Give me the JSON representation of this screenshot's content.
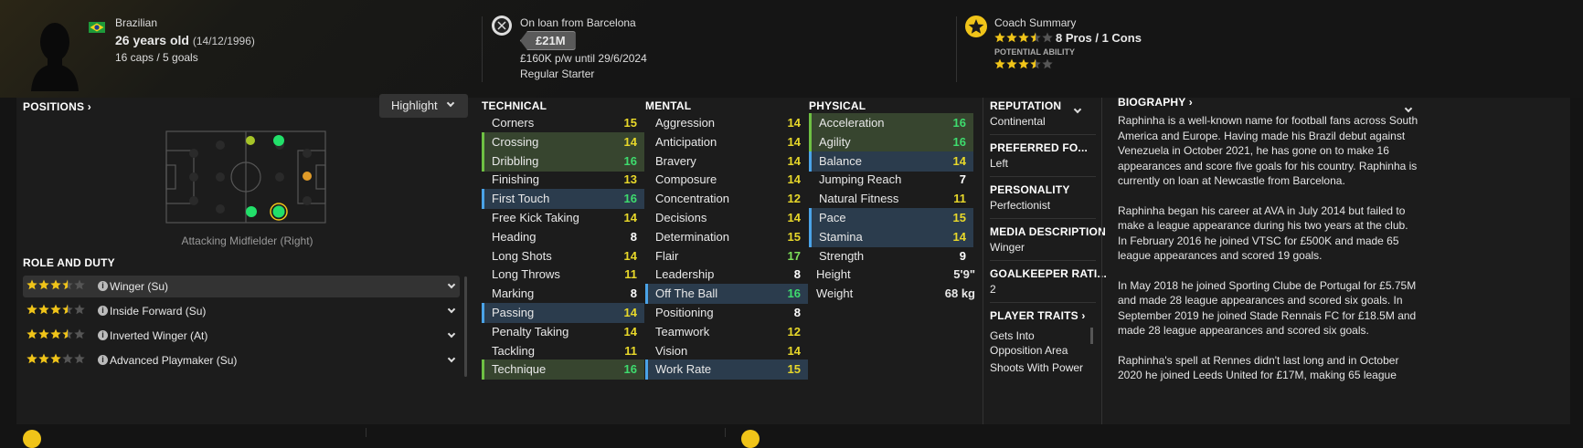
{
  "header": {
    "nationality": "Brazilian",
    "age": "26 years old",
    "dob": "(14/12/1996)",
    "caps_goals": "16 caps / 5 goals",
    "loan": "On loan from Barcelona",
    "value": "£21M",
    "wage": "£160K p/w until 29/6/2024",
    "squad_status": "Regular Starter",
    "coach_summary_label": "Coach Summary",
    "pros_cons": "8 Pros / 1 Cons",
    "potential_label": "POTENTIAL ABILITY",
    "current_stars": 3.5,
    "potential_stars": 3.5
  },
  "positions": {
    "title": "POSITIONS",
    "highlight_label": "Highlight",
    "position_label": "Attacking Midfielder (Right)"
  },
  "roles": {
    "title": "ROLE AND DUTY",
    "items": [
      {
        "name": "Winger (Su)",
        "stars": 3.5
      },
      {
        "name": "Inside Forward (Su)",
        "stars": 3.5
      },
      {
        "name": "Inverted Winger (At)",
        "stars": 3.5
      },
      {
        "name": "Advanced Playmaker (Su)",
        "stars": 3
      }
    ]
  },
  "technical": {
    "title": "TECHNICAL",
    "items": [
      {
        "name": "Corners",
        "value": "15",
        "hl": ""
      },
      {
        "name": "Crossing",
        "value": "14",
        "hl": "green"
      },
      {
        "name": "Dribbling",
        "value": "16",
        "hl": "green"
      },
      {
        "name": "Finishing",
        "value": "13",
        "hl": ""
      },
      {
        "name": "First Touch",
        "value": "16",
        "hl": "blue"
      },
      {
        "name": "Free Kick Taking",
        "value": "14",
        "hl": ""
      },
      {
        "name": "Heading",
        "value": "8",
        "hl": ""
      },
      {
        "name": "Long Shots",
        "value": "14",
        "hl": ""
      },
      {
        "name": "Long Throws",
        "value": "11",
        "hl": ""
      },
      {
        "name": "Marking",
        "value": "8",
        "hl": ""
      },
      {
        "name": "Passing",
        "value": "14",
        "hl": "blue"
      },
      {
        "name": "Penalty Taking",
        "value": "14",
        "hl": ""
      },
      {
        "name": "Tackling",
        "value": "11",
        "hl": ""
      },
      {
        "name": "Technique",
        "value": "16",
        "hl": "green"
      }
    ]
  },
  "mental": {
    "title": "MENTAL",
    "items": [
      {
        "name": "Aggression",
        "value": "14",
        "hl": ""
      },
      {
        "name": "Anticipation",
        "value": "14",
        "hl": ""
      },
      {
        "name": "Bravery",
        "value": "14",
        "hl": ""
      },
      {
        "name": "Composure",
        "value": "14",
        "hl": ""
      },
      {
        "name": "Concentration",
        "value": "12",
        "hl": ""
      },
      {
        "name": "Decisions",
        "value": "14",
        "hl": ""
      },
      {
        "name": "Determination",
        "value": "15",
        "hl": ""
      },
      {
        "name": "Flair",
        "value": "17",
        "hl": ""
      },
      {
        "name": "Leadership",
        "value": "8",
        "hl": ""
      },
      {
        "name": "Off The Ball",
        "value": "16",
        "hl": "blue"
      },
      {
        "name": "Positioning",
        "value": "8",
        "hl": ""
      },
      {
        "name": "Teamwork",
        "value": "12",
        "hl": ""
      },
      {
        "name": "Vision",
        "value": "14",
        "hl": ""
      },
      {
        "name": "Work Rate",
        "value": "15",
        "hl": "blue"
      }
    ]
  },
  "physical": {
    "title": "PHYSICAL",
    "items": [
      {
        "name": "Acceleration",
        "value": "16",
        "hl": "green"
      },
      {
        "name": "Agility",
        "value": "16",
        "hl": "green"
      },
      {
        "name": "Balance",
        "value": "14",
        "hl": "blue"
      },
      {
        "name": "Jumping Reach",
        "value": "7",
        "hl": ""
      },
      {
        "name": "Natural Fitness",
        "value": "11",
        "hl": ""
      },
      {
        "name": "Pace",
        "value": "15",
        "hl": "blue"
      },
      {
        "name": "Stamina",
        "value": "14",
        "hl": "blue"
      },
      {
        "name": "Strength",
        "value": "9",
        "hl": ""
      }
    ],
    "height_label": "Height",
    "height_value": "5'9\"",
    "weight_label": "Weight",
    "weight_value": "68 kg"
  },
  "info": {
    "reputation_label": "REPUTATION",
    "reputation_value": "Continental",
    "foot_label": "PREFERRED FO...",
    "foot_value": "Left",
    "personality_label": "PERSONALITY",
    "personality_value": "Perfectionist",
    "media_label": "MEDIA DESCRIPTION",
    "media_value": "Winger",
    "gk_label": "GOALKEEPER RATI...",
    "gk_value": "2",
    "traits_label": "PLAYER TRAITS",
    "traits": [
      "Gets Into Opposition Area",
      "Shoots With Power"
    ]
  },
  "biography": {
    "title": "BIOGRAPHY",
    "p1": "Raphinha is a well-known name for football fans across South America and Europe. Having made his Brazil debut against Venezuela in October 2021, he has gone on to make 16 appearances and score five goals for his country. Raphinha is currently on loan at Newcastle from Barcelona.",
    "p2": "Raphinha began his career at AVA in July 2014 but failed to make a league appearance during his two years at the club. In February 2016 he joined VTSC for £500K and made 65 league appearances and scored 19 goals.",
    "p3": "In May 2018 he joined Sporting Clube de Portugal for £5.75M and made 28 league appearances and scored six goals. In September 2019 he joined Stade Rennais FC for £18.5M and made 28 league appearances and scored six goals.",
    "p4": "Raphinha's spell at Rennes didn't last long and in October 2020 he joined Leeds United for £17M, making 65 league"
  },
  "colors": {
    "accent": "#f0c419",
    "green_hl": "#37452f",
    "blue_hl": "#2b3c4d"
  }
}
